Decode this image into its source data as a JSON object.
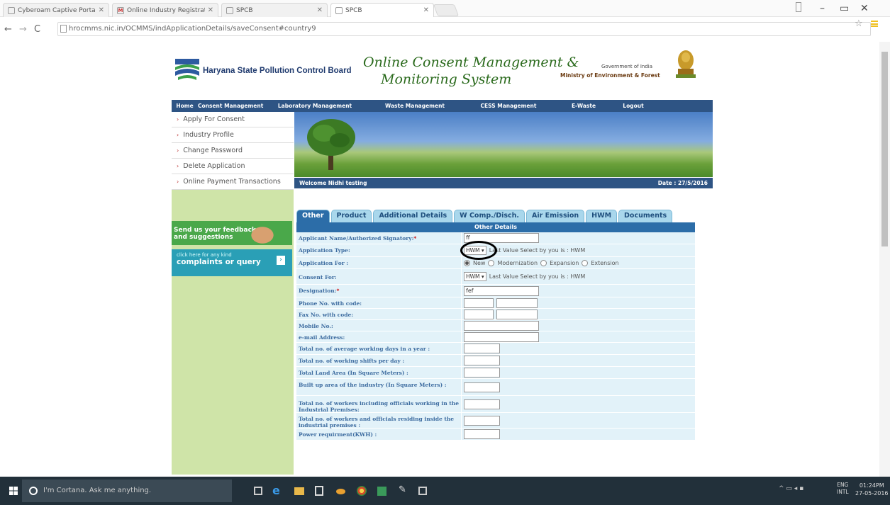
{
  "browser": {
    "tabs": [
      {
        "title": "Cyberoam Captive Portal",
        "left": 0
      },
      {
        "title": "Online Industry Registrat",
        "left": 0
      },
      {
        "title": "SPCB",
        "left": 0
      },
      {
        "title": "SPCB",
        "left": 0
      }
    ],
    "url": "hrocmms.nic.in/OCMMS/indApplicationDetails/saveConsent#country9"
  },
  "header": {
    "board": "Haryana State Pollution Control Board",
    "system_line1": "Online Consent Management &",
    "system_line2": "Monitoring System",
    "gov": "Government of India",
    "ministry": "Ministry of Environment & Forest"
  },
  "topnav": [
    "Home",
    "Consent Management",
    "Laboratory Management",
    "Waste Management",
    "CESS Management",
    "E-Waste",
    "Logout"
  ],
  "sidebar": {
    "items": [
      "Apply For Consent",
      "Industry Profile",
      "Change Password",
      "Delete Application",
      "Online Payment Transactions"
    ],
    "feedback_line1": "Send us your feedback",
    "feedback_line2": "and suggestions",
    "complaint_small": "click here for any kind",
    "complaint_big": "complaints or query"
  },
  "welcome": {
    "text": "Welcome Nidhi testing",
    "date": "Date : 27/5/2016"
  },
  "form_tabs": [
    "Other",
    "Product",
    "Additional Details",
    "W Comp./Disch.",
    "Air Emission",
    "HWM",
    "Documents"
  ],
  "form": {
    "title": "Other Details",
    "applicant_label": "Applicant Name/Authorized Signatory:",
    "applicant_value": "ff",
    "app_type_label": "Application Type:",
    "app_type_select": "HWM",
    "app_type_note": "Last Value Select by you is : HWM",
    "app_for_label": "Application For :",
    "app_for_options": [
      "New",
      "Modernization",
      "Expansion",
      "Extension"
    ],
    "consent_for_label": "Consent For:",
    "consent_for_select": "HWM",
    "consent_for_note": "Last Value Select by you is : HWM",
    "designation_label": "Designation:",
    "designation_value": "fef",
    "phone_label": "Phone No. with code:",
    "fax_label": "Fax No. with code:",
    "mobile_label": "Mobile No.:",
    "email_label": "e-mail Address:",
    "working_days_label": "Total no. of average working days in a year :",
    "shifts_label": "Total no. of working shifts per day :",
    "land_area_label": "Total Land Area (In Square Meters) :",
    "built_up_label": "Built up area of the industry (In Square Meters) :",
    "workers_label": "Total no. of workers including officials working in the Industrial Premises:",
    "residing_label": "Total no. of workers and officials residing inside the industrial premises :",
    "power_label": "Power requirment(KWH) :"
  },
  "taskbar": {
    "cortana": "I'm Cortana. Ask me anything.",
    "lang1": "ENG",
    "lang2": "INTL",
    "time": "01:24PM",
    "date": "27-05-2016"
  }
}
